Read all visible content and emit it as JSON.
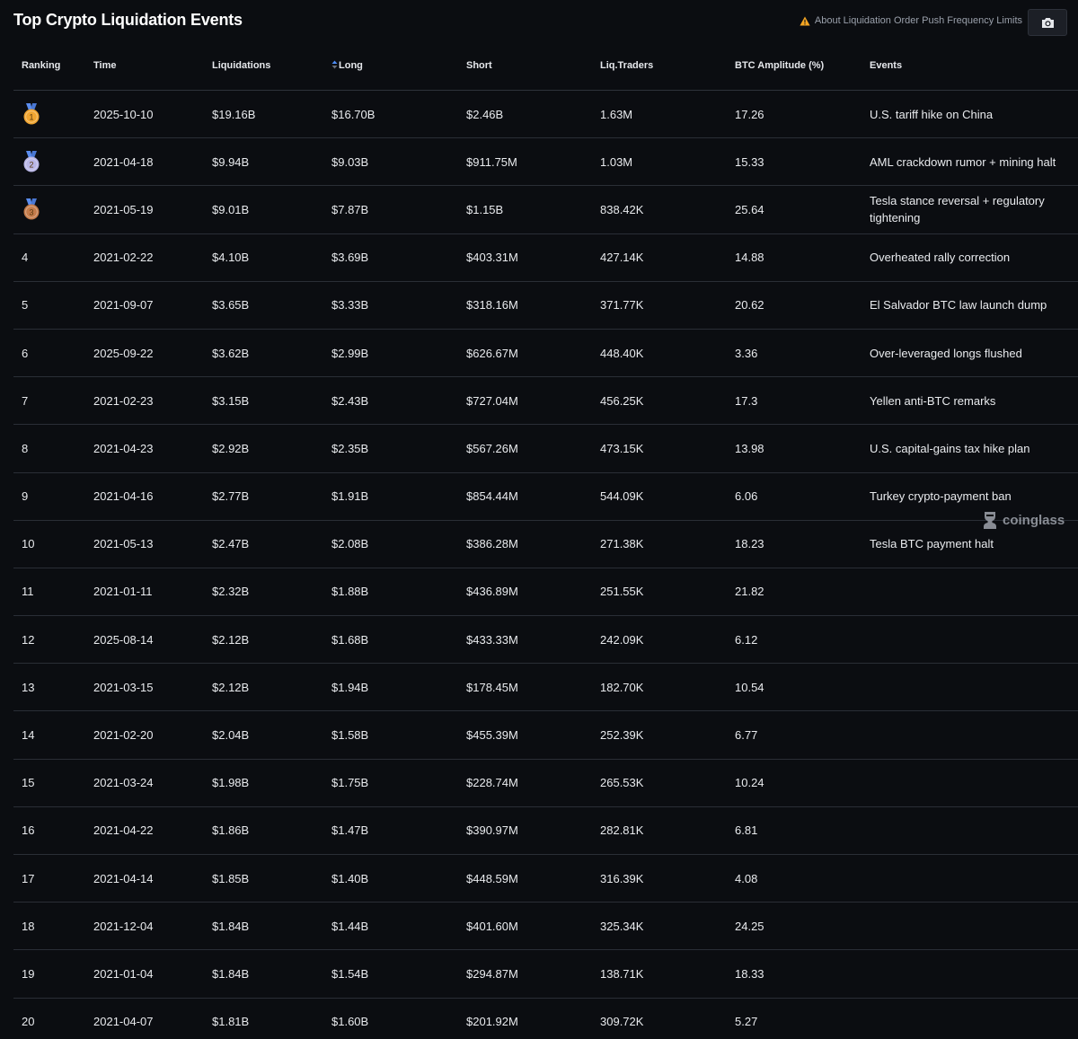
{
  "header": {
    "title": "Top Crypto Liquidation Events",
    "notice": "About Liquidation Order Push Frequency Limits",
    "warning_color": "#f5a623",
    "camera_icon": "camera-icon"
  },
  "columns": {
    "ranking": "Ranking",
    "time": "Time",
    "liquidations": "Liquidations",
    "long": "Long",
    "short": "Short",
    "liq_traders": "Liq.Traders",
    "btc_amplitude": "BTC Amplitude (%)",
    "events": "Events"
  },
  "rows": [
    {
      "rank": "1",
      "time": "2025-10-10",
      "liquidations": "$19.16B",
      "long": "$16.70B",
      "short": "$2.46B",
      "traders": "1.63M",
      "amplitude": "17.26",
      "event": "U.S. tariff hike on China"
    },
    {
      "rank": "2",
      "time": "2021-04-18",
      "liquidations": "$9.94B",
      "long": "$9.03B",
      "short": "$911.75M",
      "traders": "1.03M",
      "amplitude": "15.33",
      "event": "AML crackdown rumor + mining halt"
    },
    {
      "rank": "3",
      "time": "2021-05-19",
      "liquidations": "$9.01B",
      "long": "$7.87B",
      "short": "$1.15B",
      "traders": "838.42K",
      "amplitude": "25.64",
      "event": "Tesla stance reversal + regulatory tightening"
    },
    {
      "rank": "4",
      "time": "2021-02-22",
      "liquidations": "$4.10B",
      "long": "$3.69B",
      "short": "$403.31M",
      "traders": "427.14K",
      "amplitude": "14.88",
      "event": "Overheated rally correction"
    },
    {
      "rank": "5",
      "time": "2021-09-07",
      "liquidations": "$3.65B",
      "long": "$3.33B",
      "short": "$318.16M",
      "traders": "371.77K",
      "amplitude": "20.62",
      "event": "El Salvador BTC law launch dump"
    },
    {
      "rank": "6",
      "time": "2025-09-22",
      "liquidations": "$3.62B",
      "long": "$2.99B",
      "short": "$626.67M",
      "traders": "448.40K",
      "amplitude": "3.36",
      "event": "Over-leveraged longs flushed"
    },
    {
      "rank": "7",
      "time": "2021-02-23",
      "liquidations": "$3.15B",
      "long": "$2.43B",
      "short": "$727.04M",
      "traders": "456.25K",
      "amplitude": "17.3",
      "event": "Yellen anti-BTC remarks"
    },
    {
      "rank": "8",
      "time": "2021-04-23",
      "liquidations": "$2.92B",
      "long": "$2.35B",
      "short": "$567.26M",
      "traders": "473.15K",
      "amplitude": "13.98",
      "event": "U.S. capital-gains tax hike plan"
    },
    {
      "rank": "9",
      "time": "2021-04-16",
      "liquidations": "$2.77B",
      "long": "$1.91B",
      "short": "$854.44M",
      "traders": "544.09K",
      "amplitude": "6.06",
      "event": "Turkey crypto-payment ban"
    },
    {
      "rank": "10",
      "time": "2021-05-13",
      "liquidations": "$2.47B",
      "long": "$2.08B",
      "short": "$386.28M",
      "traders": "271.38K",
      "amplitude": "18.23",
      "event": "Tesla BTC payment halt"
    },
    {
      "rank": "11",
      "time": "2021-01-11",
      "liquidations": "$2.32B",
      "long": "$1.88B",
      "short": "$436.89M",
      "traders": "251.55K",
      "amplitude": "21.82",
      "event": ""
    },
    {
      "rank": "12",
      "time": "2025-08-14",
      "liquidations": "$2.12B",
      "long": "$1.68B",
      "short": "$433.33M",
      "traders": "242.09K",
      "amplitude": "6.12",
      "event": ""
    },
    {
      "rank": "13",
      "time": "2021-03-15",
      "liquidations": "$2.12B",
      "long": "$1.94B",
      "short": "$178.45M",
      "traders": "182.70K",
      "amplitude": "10.54",
      "event": ""
    },
    {
      "rank": "14",
      "time": "2021-02-20",
      "liquidations": "$2.04B",
      "long": "$1.58B",
      "short": "$455.39M",
      "traders": "252.39K",
      "amplitude": "6.77",
      "event": ""
    },
    {
      "rank": "15",
      "time": "2021-03-24",
      "liquidations": "$1.98B",
      "long": "$1.75B",
      "short": "$228.74M",
      "traders": "265.53K",
      "amplitude": "10.24",
      "event": ""
    },
    {
      "rank": "16",
      "time": "2021-04-22",
      "liquidations": "$1.86B",
      "long": "$1.47B",
      "short": "$390.97M",
      "traders": "282.81K",
      "amplitude": "6.81",
      "event": ""
    },
    {
      "rank": "17",
      "time": "2021-04-14",
      "liquidations": "$1.85B",
      "long": "$1.40B",
      "short": "$448.59M",
      "traders": "316.39K",
      "amplitude": "4.08",
      "event": ""
    },
    {
      "rank": "18",
      "time": "2021-12-04",
      "liquidations": "$1.84B",
      "long": "$1.44B",
      "short": "$401.60M",
      "traders": "325.34K",
      "amplitude": "24.25",
      "event": ""
    },
    {
      "rank": "19",
      "time": "2021-01-04",
      "liquidations": "$1.84B",
      "long": "$1.54B",
      "short": "$294.87M",
      "traders": "138.71K",
      "amplitude": "18.33",
      "event": ""
    },
    {
      "rank": "20",
      "time": "2021-04-07",
      "liquidations": "$1.81B",
      "long": "$1.60B",
      "short": "$201.92M",
      "traders": "309.72K",
      "amplitude": "5.27",
      "event": ""
    }
  ],
  "medals": {
    "gold": "#f0a531",
    "silver": "#b9b6e6",
    "bronze": "#c47b4a"
  },
  "watermark": {
    "text": "coinglass",
    "icon": "coinglass-logo-icon"
  }
}
